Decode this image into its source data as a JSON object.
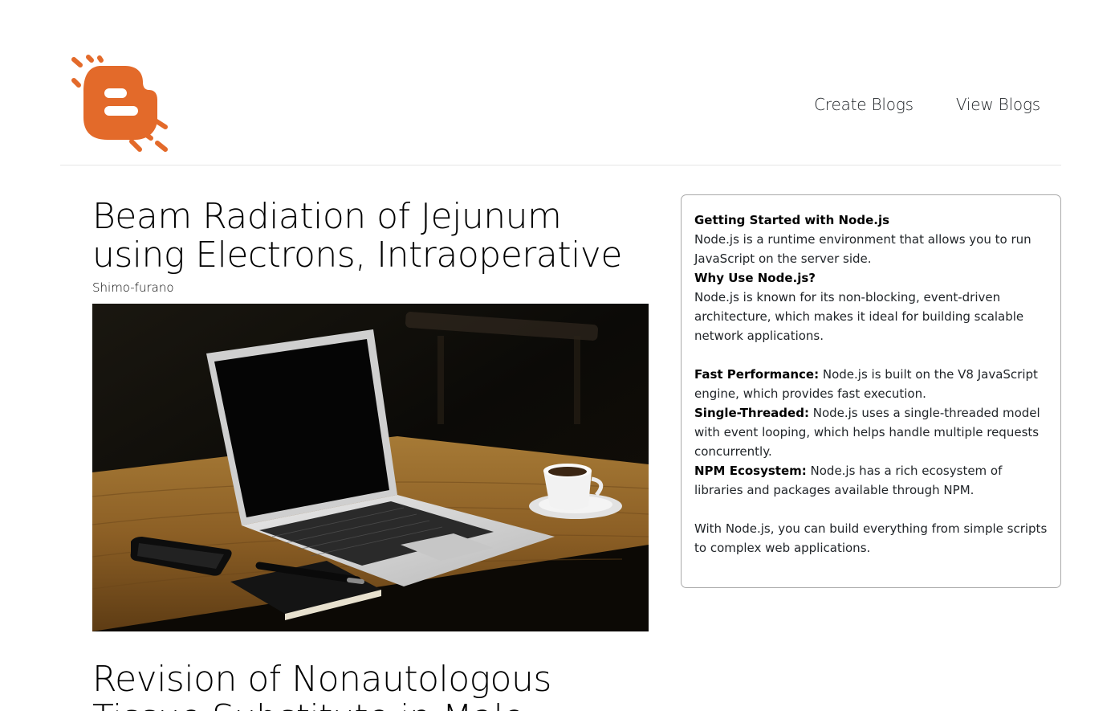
{
  "nav": {
    "create_label": "Create Blogs",
    "view_label": "View Blogs"
  },
  "brand": {
    "logo_icon": "blogger-logo-icon",
    "accent": "#e36a2a"
  },
  "posts": [
    {
      "title": "Beam Radiation of Jejunum using Electrons, Intraoperative",
      "author": "Shimo-furano",
      "image_alt": "laptop-on-table"
    },
    {
      "title": "Revision of Nonautologous Tissue Substitute in Male"
    }
  ],
  "sidebar": {
    "heading1": "Getting Started with Node.js",
    "para1": "Node.js is a runtime environment that allows you to run JavaScript on the server side.",
    "heading2": "Why Use Node.js?",
    "para2": "Node.js is known for its non-blocking, event-driven architecture, which makes it ideal for building scalable network applications.",
    "features": [
      {
        "label": "Fast Performance:",
        "text": " Node.js is built on the V8 JavaScript engine, which provides fast execution."
      },
      {
        "label": "Single-Threaded:",
        "text": " Node.js uses a single-threaded model with event looping, which helps handle multiple requests concurrently."
      },
      {
        "label": "NPM Ecosystem:",
        "text": " Node.js has a rich ecosystem of libraries and packages available through NPM."
      }
    ],
    "closing": "With Node.js, you can build everything from simple scripts to complex web applications."
  }
}
